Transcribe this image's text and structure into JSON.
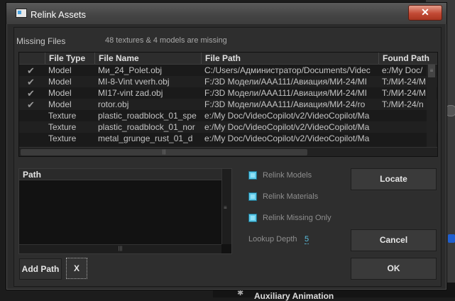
{
  "window": {
    "title": "Relink Assets",
    "close_label": "✕"
  },
  "missing": {
    "section_title": "Missing Files",
    "note": "48 textures & 4 models are missing"
  },
  "table": {
    "columns": [
      "File Type",
      "File Name",
      "File Path",
      "Found Path"
    ],
    "rows": [
      {
        "found": true,
        "type": "Model",
        "name": "Ми_24_Polet.obj",
        "path": "C:/Users/Администратор/Documents/Videc",
        "found_path": "e:/My Doc/"
      },
      {
        "found": true,
        "type": "Model",
        "name": "MI-8-Vint vverh.obj",
        "path": "F:/3D Модели/ААА111/Авиация/МИ-24/МI",
        "found_path": "T:/МИ-24/M"
      },
      {
        "found": true,
        "type": "Model",
        "name": "MI17-vint zad.obj",
        "path": "F:/3D Модели/ААА111/Авиация/МИ-24/МI",
        "found_path": "T:/МИ-24/M"
      },
      {
        "found": true,
        "type": "Model",
        "name": "rotor.obj",
        "path": "F:/3D Модели/ААА111/Авиация/МИ-24/ro",
        "found_path": "T:/МИ-24/n"
      },
      {
        "found": false,
        "type": "Texture",
        "name": "plastic_roadblock_01_spe",
        "path": "e:/My Doc/VideoCopilot/v2/VideoCopilot/Ma",
        "found_path": ""
      },
      {
        "found": false,
        "type": "Texture",
        "name": "plastic_roadblock_01_nor",
        "path": "e:/My Doc/VideoCopilot/v2/VideoCopilot/Ma",
        "found_path": ""
      },
      {
        "found": false,
        "type": "Texture",
        "name": "metal_grunge_rust_01_d",
        "path": "e:/My Doc/VideoCopilot/v2/VideoCopilot/Ma",
        "found_path": ""
      }
    ]
  },
  "path_list": {
    "header": "Path",
    "items": []
  },
  "options": {
    "relink_models": {
      "label": "Relink Models",
      "checked": true
    },
    "relink_materials": {
      "label": "Relink Materials",
      "checked": true
    },
    "relink_missing_only": {
      "label": "Relink Missing Only",
      "checked": true
    },
    "lookup_depth_label": "Lookup Depth",
    "lookup_depth_value": "5"
  },
  "buttons": {
    "locate": "Locate",
    "cancel": "Cancel",
    "ok": "OK",
    "add_path": "Add Path",
    "remove": "X"
  },
  "background": {
    "aux_label": "Auxiliary Animation"
  },
  "colors": {
    "accent_checkbox": "#5bc8e8",
    "close_button": "#c24a35",
    "lookup_value": "#5ac0e0"
  }
}
